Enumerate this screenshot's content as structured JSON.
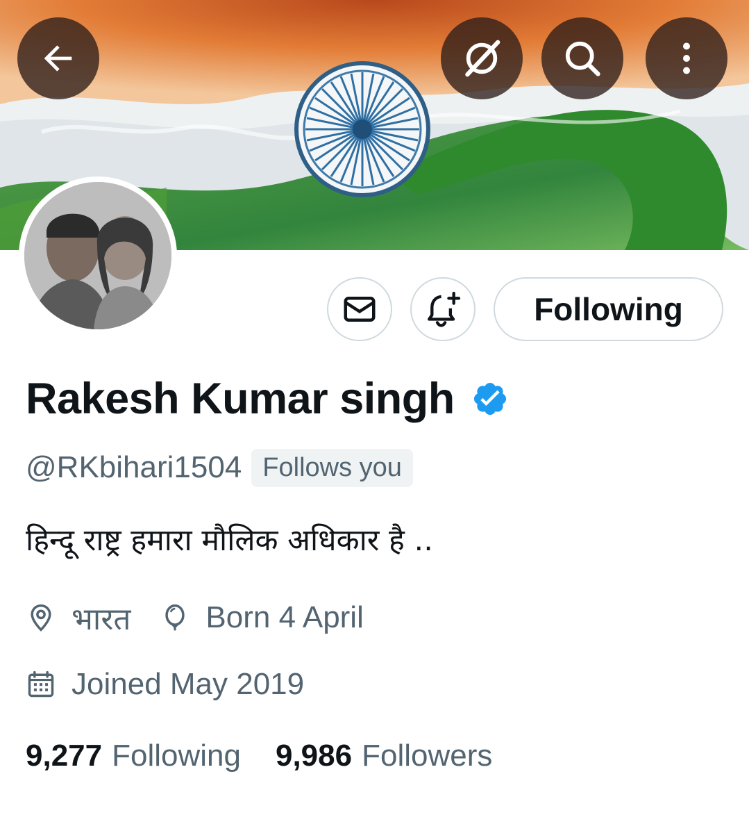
{
  "profile": {
    "display_name": "Rakesh Kumar singh",
    "handle": "@RKbihari1504",
    "follows_you": "Follows you",
    "bio": "हिन्दू राष्ट्र हमारा मौलिक अधिकार है ..",
    "location": "भारत",
    "birthday": "Born 4 April",
    "joined": "Joined May 2019",
    "verified": true
  },
  "stats": {
    "following_count": "9,277",
    "following_label": "Following",
    "followers_count": "9,986",
    "followers_label": "Followers"
  },
  "actions": {
    "follow_state_label": "Following"
  },
  "icons": {
    "back": "arrow-left-icon",
    "grok": "grok-icon",
    "search": "search-icon",
    "more": "more-vertical-icon",
    "message": "envelope-icon",
    "notify": "bell-plus-icon",
    "verified": "verified-badge-icon",
    "location": "location-pin-icon",
    "birthday": "balloon-icon",
    "joined": "calendar-icon"
  },
  "colors": {
    "verified_blue": "#1d9bf0",
    "secondary_text": "#536471",
    "primary_text": "#0f1419",
    "border": "#cfd9de"
  }
}
